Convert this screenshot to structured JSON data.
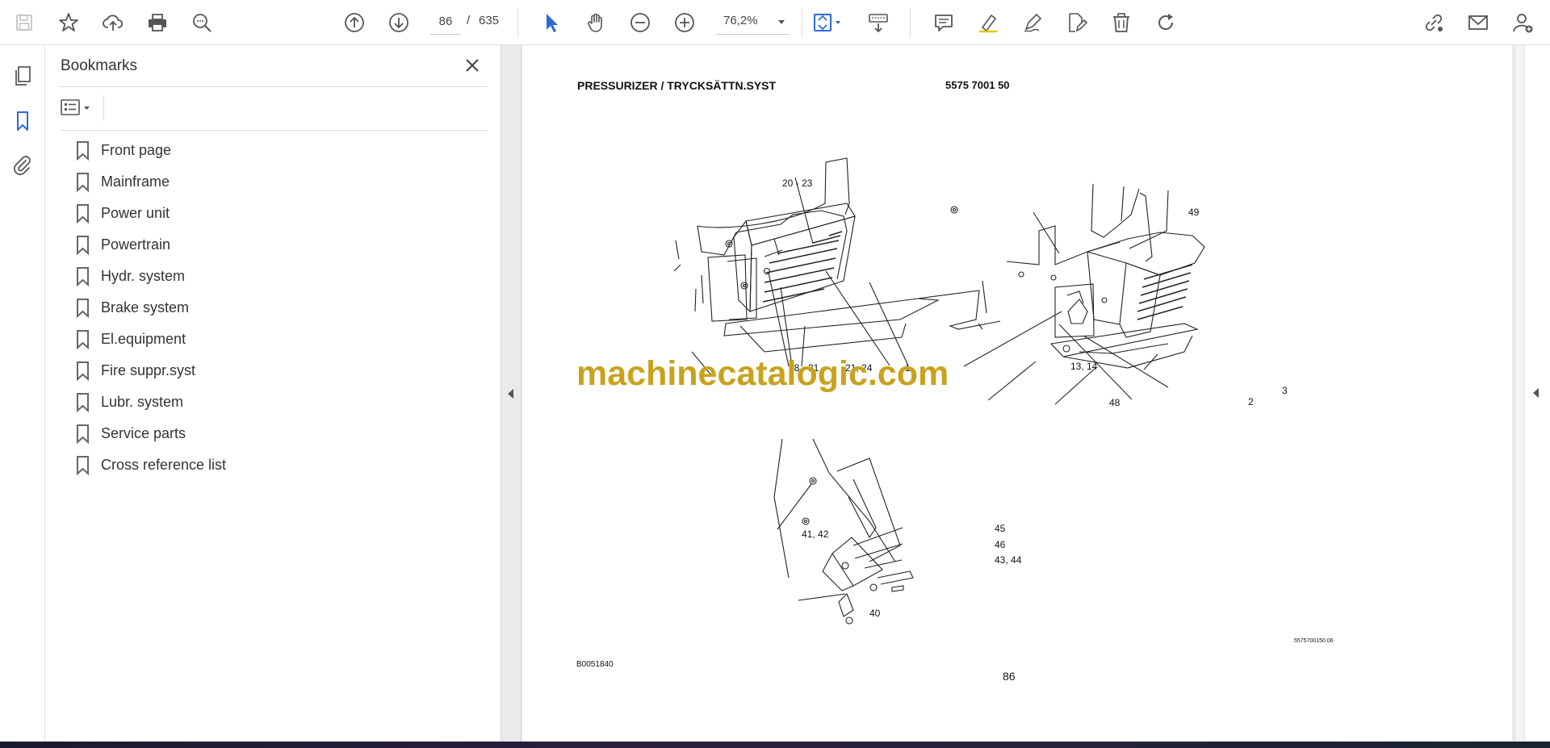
{
  "toolbar": {
    "page_current": "86",
    "page_separator": "/",
    "page_total": "635",
    "zoom": "76,2%"
  },
  "bookmarks_panel": {
    "title": "Bookmarks",
    "items": [
      {
        "label": "Front page"
      },
      {
        "label": "Mainframe"
      },
      {
        "label": "Power unit"
      },
      {
        "label": "Powertrain"
      },
      {
        "label": "Hydr. system"
      },
      {
        "label": "Brake system"
      },
      {
        "label": "El.equipment"
      },
      {
        "label": "Fire suppr.syst"
      },
      {
        "label": "Lubr. system"
      },
      {
        "label": "Service parts"
      },
      {
        "label": "Cross reference list"
      }
    ]
  },
  "document": {
    "header": "PRESSURIZER / TRYCKSÄTTN.SYST",
    "part_number": "5575 7001 50",
    "watermark": "machinecatalogic.com",
    "figure_code": "B0051840",
    "page_number": "86",
    "image_code": "5575700150 06",
    "callouts": {
      "c_20_23": "20 - 23",
      "c_21_24": "21, 24",
      "c_1": "1",
      "c_28": "28",
      "c_31": "31",
      "c_49": "49",
      "c_13_14": "13, 14",
      "c_48": "48",
      "c_2": "2",
      "c_3": "3",
      "c_41_42": "41, 42",
      "c_45": "45",
      "c_46": "46",
      "c_43_44": "43, 44",
      "c_40": "40"
    }
  },
  "colors": {
    "accent_blue": "#2c6bd6",
    "icon_gray": "#6b6b6b",
    "watermark_gold": "#c9a21d"
  }
}
